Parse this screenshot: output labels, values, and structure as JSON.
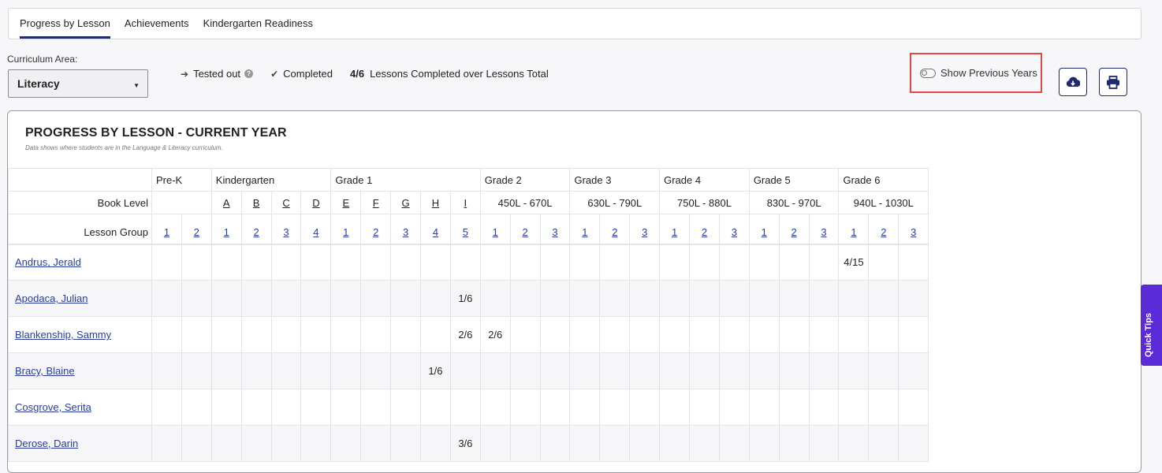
{
  "tabs": [
    "Progress by Lesson",
    "Achievements",
    "Kindergarten Readiness"
  ],
  "curriculum": {
    "label": "Curriculum Area:",
    "value": "Literacy"
  },
  "legend": {
    "tested_out": "Tested out",
    "completed": "Completed",
    "ratio": "4/6",
    "ratio_desc": "Lessons Completed over Lessons Total"
  },
  "show_previous": "Show Previous Years",
  "card": {
    "title": "PROGRESS BY LESSON - CURRENT YEAR",
    "subtitle": "Data shows where students are in the Language & Literacy curriculum."
  },
  "table": {
    "book_level_label": "Book Level",
    "lesson_group_label": "Lesson Group",
    "grades": [
      {
        "name": "Pre-K",
        "levels": [],
        "groups": [
          "1",
          "2"
        ]
      },
      {
        "name": "Kindergarten",
        "levels": [
          "A",
          "B",
          "C",
          "D"
        ],
        "groups": [
          "1",
          "2",
          "3",
          "4"
        ]
      },
      {
        "name": "Grade 1",
        "levels": [
          "E",
          "F",
          "G",
          "H",
          "I"
        ],
        "groups": [
          "1",
          "2",
          "3",
          "4",
          "5"
        ]
      },
      {
        "name": "Grade 2",
        "range": "450L - 670L",
        "groups": [
          "1",
          "2",
          "3"
        ]
      },
      {
        "name": "Grade 3",
        "range": "630L - 790L",
        "groups": [
          "1",
          "2",
          "3"
        ]
      },
      {
        "name": "Grade 4",
        "range": "750L - 880L",
        "groups": [
          "1",
          "2",
          "3"
        ]
      },
      {
        "name": "Grade 5",
        "range": "830L - 970L",
        "groups": [
          "1",
          "2",
          "3"
        ]
      },
      {
        "name": "Grade 6",
        "range": "940L - 1030L",
        "groups": [
          "1",
          "2",
          "3"
        ]
      }
    ],
    "students": [
      {
        "name": "Andrus, Jerald",
        "cells": {
          "23": "4/15"
        }
      },
      {
        "name": "Apodaca, Julian",
        "cells": {
          "10": "1/6"
        }
      },
      {
        "name": "Blankenship, Sammy",
        "cells": {
          "10": "2/6",
          "11": "2/6"
        }
      },
      {
        "name": "Bracy, Blaine",
        "cells": {
          "9": "1/6"
        }
      },
      {
        "name": "Cosgrove, Serita",
        "cells": {}
      },
      {
        "name": "Derose, Darin",
        "cells": {
          "10": "3/6"
        }
      }
    ]
  },
  "quick_tips": "Quick Tips",
  "colors": {
    "brand": "#1f2b6e",
    "highlight": "#e04848",
    "quick_tips": "#5b2bd8",
    "link": "#2a3d9c"
  }
}
